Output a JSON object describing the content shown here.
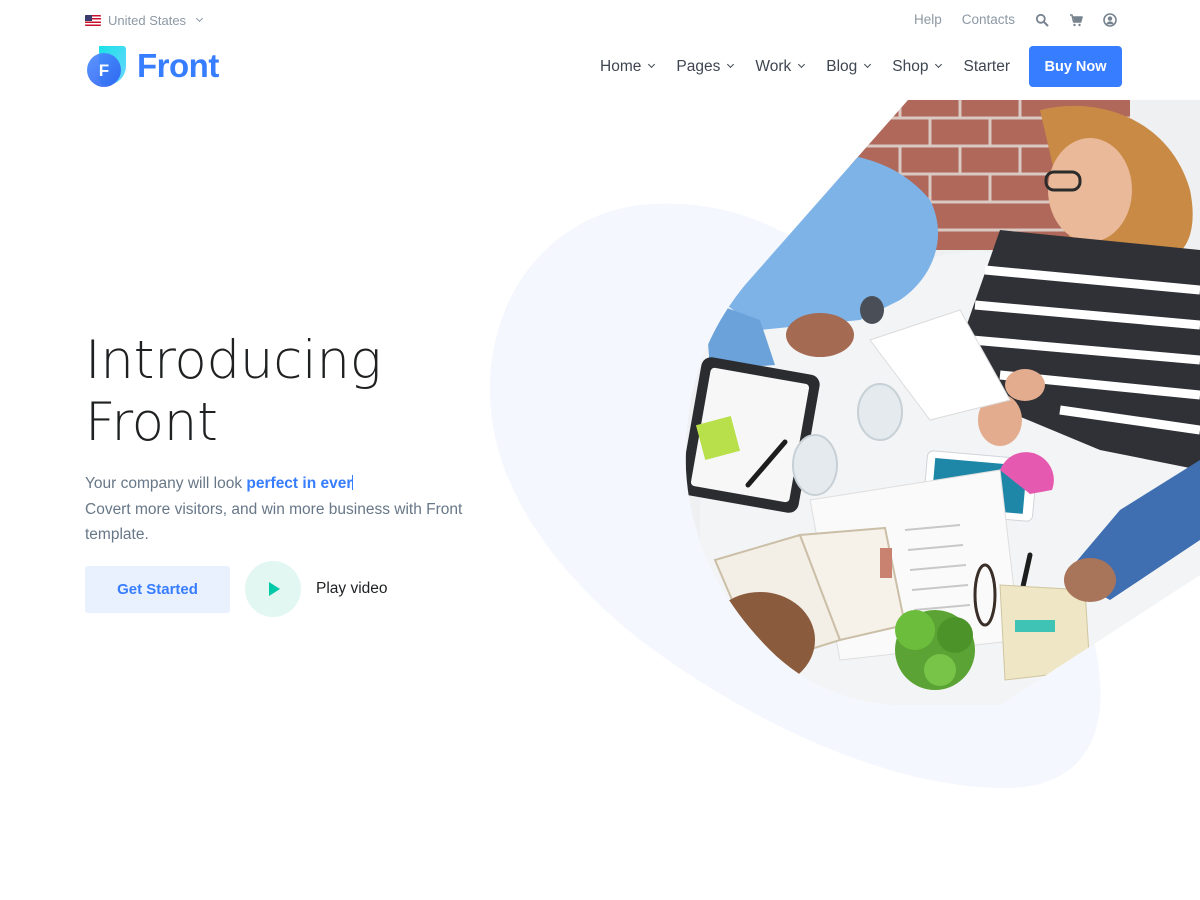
{
  "topbar": {
    "locale": "United States",
    "links": {
      "help": "Help",
      "contacts": "Contacts"
    },
    "icons": [
      "search-icon",
      "cart-icon",
      "account-icon"
    ]
  },
  "brand": {
    "name": "Front",
    "mark_letter": "F"
  },
  "nav": {
    "items": [
      {
        "label": "Home",
        "dropdown": true
      },
      {
        "label": "Pages",
        "dropdown": true
      },
      {
        "label": "Work",
        "dropdown": true
      },
      {
        "label": "Blog",
        "dropdown": true
      },
      {
        "label": "Shop",
        "dropdown": true
      },
      {
        "label": "Starter",
        "dropdown": false
      }
    ],
    "cta": "Buy Now"
  },
  "hero": {
    "title_line1": "Introducing",
    "title_line2": "Front",
    "lead_prefix": "Your company will look ",
    "lead_highlight": "perfect in ever",
    "lead_rest": "Covert more visitors, and win more business with Front template.",
    "primary_button": "Get Started",
    "video_label": "Play video",
    "image_description": "team-meeting-photo"
  },
  "colors": {
    "primary": "#377dff",
    "primary_soft": "#e9f1ff",
    "accent_green": "#00c9a7",
    "blob": "#f4f7fd",
    "text_muted": "#677788"
  }
}
